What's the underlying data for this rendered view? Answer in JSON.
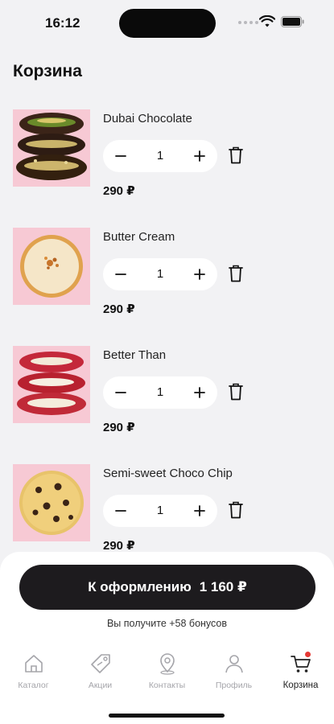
{
  "status_bar": {
    "time": "16:12"
  },
  "page": {
    "title": "Корзина"
  },
  "cart": {
    "items": [
      {
        "name": "Dubai Chocolate",
        "quantity": "1",
        "price": "290 ₽"
      },
      {
        "name": "Butter Cream",
        "quantity": "1",
        "price": "290 ₽"
      },
      {
        "name": "Better Than",
        "quantity": "1",
        "price": "290 ₽"
      },
      {
        "name": "Semi-sweet Choco Chip",
        "quantity": "1",
        "price": "290 ₽"
      }
    ],
    "stepper": {
      "minus_icon": "minus-icon",
      "plus_icon": "plus-icon",
      "delete_icon": "trash-icon"
    }
  },
  "checkout": {
    "button_label": "К оформлению",
    "total": "1 160 ₽",
    "bonus_note": "Вы получите +58 бонусов"
  },
  "tab_bar": {
    "tabs": [
      {
        "label": "Каталог",
        "icon": "home-icon"
      },
      {
        "label": "Акции",
        "icon": "tag-icon"
      },
      {
        "label": "Контакты",
        "icon": "location-icon"
      },
      {
        "label": "Профиль",
        "icon": "user-icon"
      },
      {
        "label": "Корзина",
        "icon": "cart-icon",
        "active": true
      }
    ]
  },
  "colors": {
    "background": "#f2f2f4",
    "thumb_background": "#f7c9d4",
    "checkout_button": "#1d1b1e",
    "badge": "#e53935",
    "inactive_tab": "#a5a5aa"
  }
}
